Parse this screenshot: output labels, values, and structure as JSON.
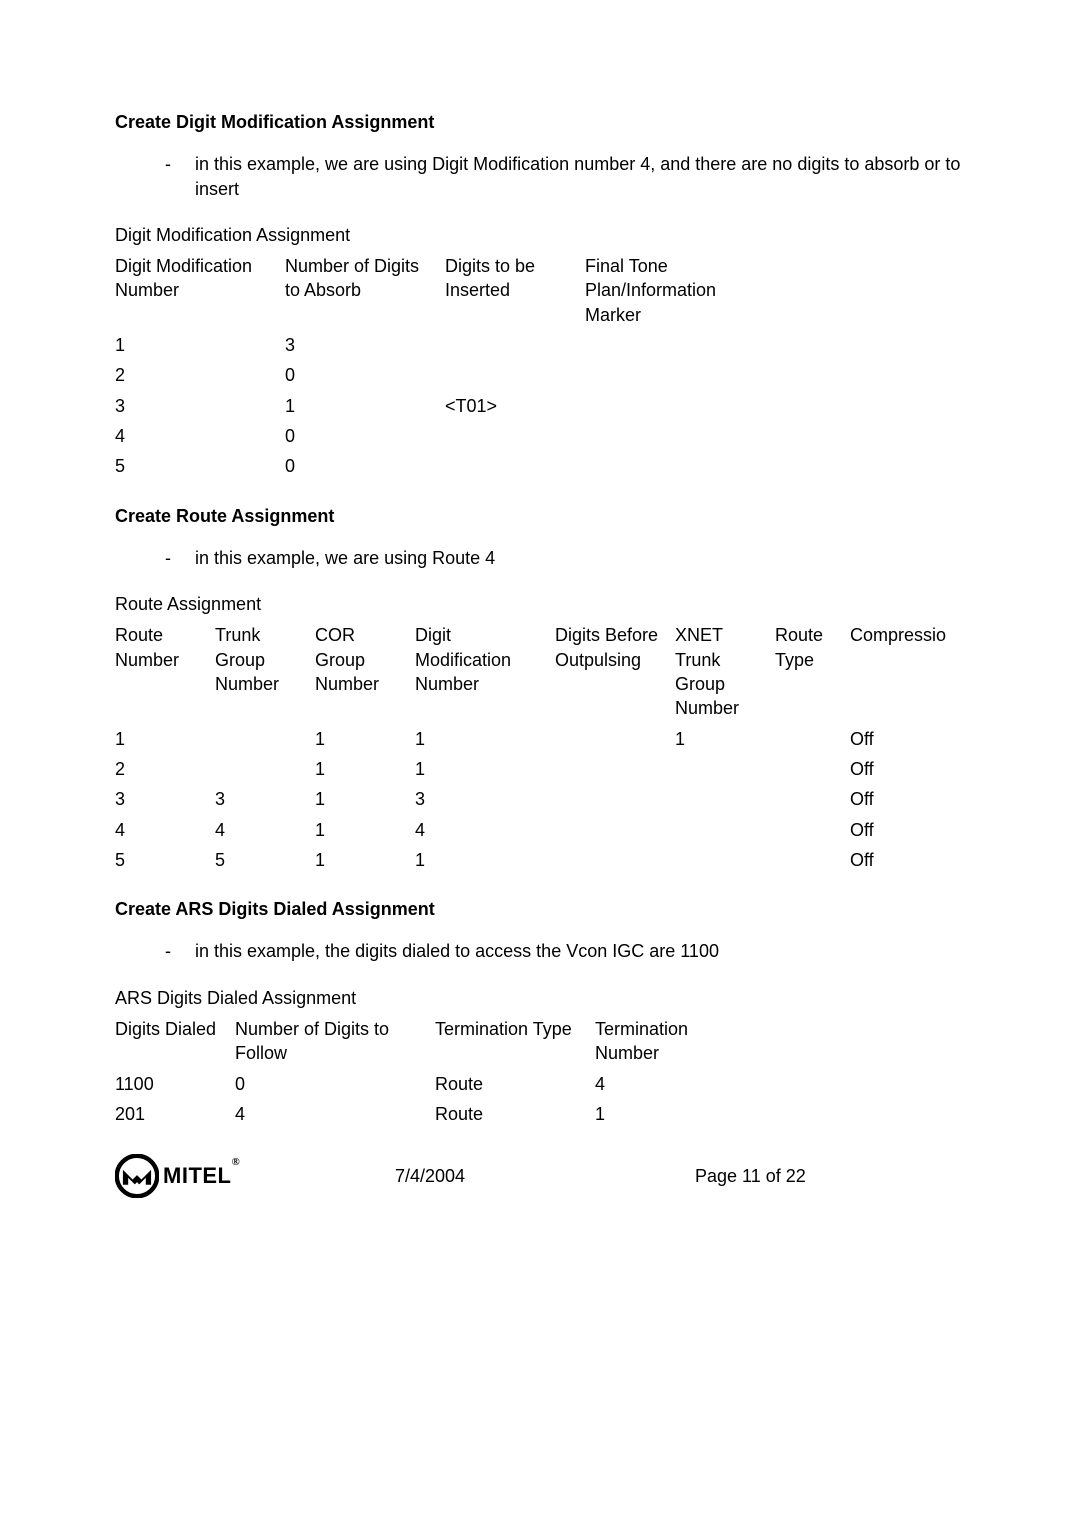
{
  "section1": {
    "heading": "Create Digit Modification Assignment",
    "bullet": "in this example, we are using Digit Modification number 4, and there are no digits to absorb or to insert",
    "tableTitle": "Digit Modification Assignment",
    "headers": {
      "c1": "Digit Modification Number",
      "c2": "Number of Digits to Absorb",
      "c3": "Digits to be Inserted",
      "c4": "Final Tone Plan/Information Marker"
    },
    "rows": [
      {
        "c1": "1",
        "c2": "3",
        "c3": "",
        "c4": ""
      },
      {
        "c1": "2",
        "c2": "0",
        "c3": "",
        "c4": ""
      },
      {
        "c1": "3",
        "c2": "1",
        "c3": "<T01>",
        "c4": ""
      },
      {
        "c1": "4",
        "c2": "0",
        "c3": "",
        "c4": ""
      },
      {
        "c1": "5",
        "c2": "0",
        "c3": "",
        "c4": ""
      }
    ]
  },
  "section2": {
    "heading": "Create Route Assignment",
    "bullet": "in this example, we are using Route 4",
    "tableTitle": "Route Assignment",
    "headers": {
      "c1": "Route Number",
      "c2": "Trunk Group Number",
      "c3": "COR Group Number",
      "c4": "Digit Modification Number",
      "c5": "Digits Before Outpulsing",
      "c6": "XNET Trunk Group Number",
      "c7": "Route Type",
      "c8": "Compressio"
    },
    "rows": [
      {
        "c1": "1",
        "c2": "",
        "c3": "1",
        "c4": "1",
        "c5": "",
        "c6": "1",
        "c7": "",
        "c8": "Off"
      },
      {
        "c1": "2",
        "c2": "",
        "c3": "1",
        "c4": "1",
        "c5": "",
        "c6": "",
        "c7": "",
        "c8": "Off"
      },
      {
        "c1": "3",
        "c2": "3",
        "c3": "1",
        "c4": "3",
        "c5": "",
        "c6": "",
        "c7": "",
        "c8": "Off"
      },
      {
        "c1": "4",
        "c2": "4",
        "c3": "1",
        "c4": "4",
        "c5": "",
        "c6": "",
        "c7": "",
        "c8": "Off"
      },
      {
        "c1": "5",
        "c2": "5",
        "c3": "1",
        "c4": "1",
        "c5": "",
        "c6": "",
        "c7": "",
        "c8": "Off"
      }
    ]
  },
  "section3": {
    "heading": "Create ARS Digits Dialed Assignment",
    "bullet": "in this example, the digits dialed to access the Vcon IGC are 1100",
    "tableTitle": "ARS Digits Dialed Assignment",
    "headers": {
      "c1": "Digits Dialed",
      "c2": "Number of Digits to Follow",
      "c3": "Termination Type",
      "c4": "Termination Number"
    },
    "rows": [
      {
        "c1": "1100",
        "c2": "0",
        "c3": "Route",
        "c4": "4"
      },
      {
        "c1": "201",
        "c2": "4",
        "c3": "Route",
        "c4": "1"
      }
    ]
  },
  "footer": {
    "brand": "MITEL",
    "date": "7/4/2004",
    "page": "Page 11 of 22"
  }
}
